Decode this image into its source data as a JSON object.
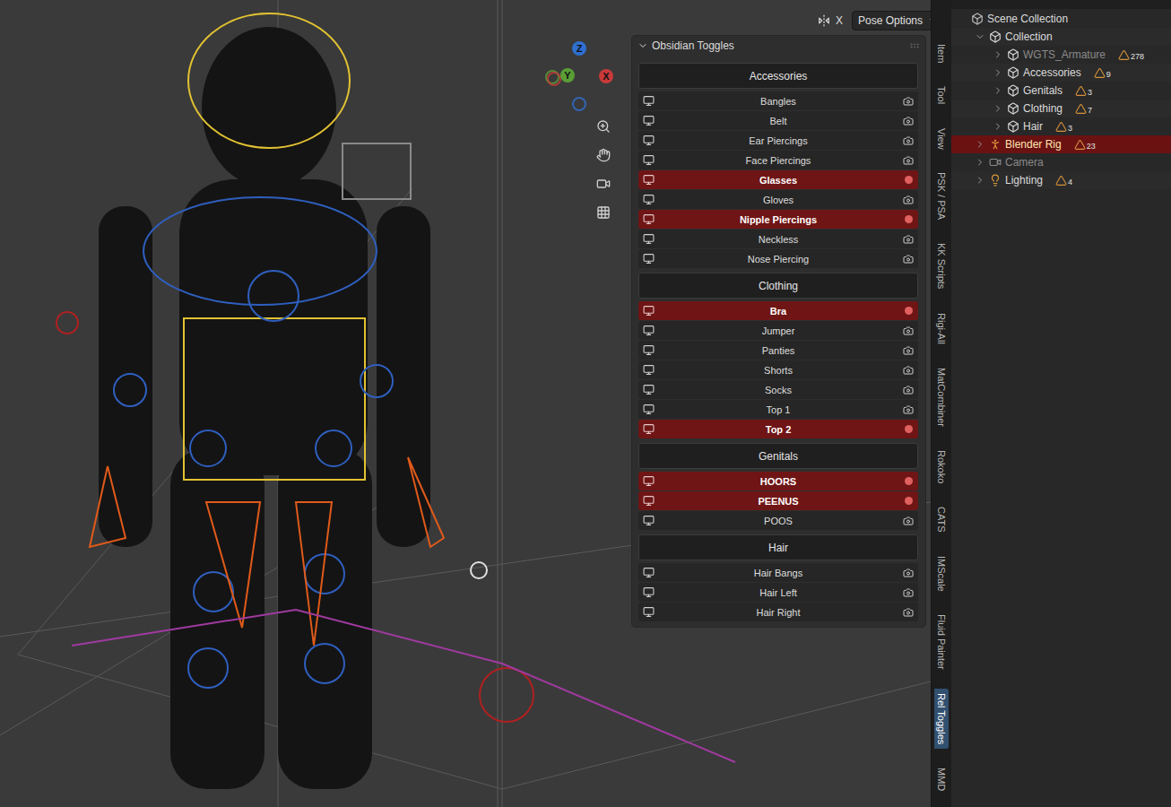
{
  "viewport": {
    "header": {
      "mirror_label": "X",
      "pose_options": "Pose Options"
    },
    "gizmo": [
      {
        "label": "Z",
        "color": "#2f6fd0"
      },
      {
        "label": "Y",
        "color": "#5a9e36"
      },
      {
        "label": "X",
        "color": "#c83a3a"
      }
    ]
  },
  "panel": {
    "title": "Obsidian Toggles",
    "expanded": true,
    "sections": [
      {
        "title": "Accessories",
        "items": [
          {
            "label": "Bangles",
            "hidden": false
          },
          {
            "label": "Belt",
            "hidden": false
          },
          {
            "label": "Ear Piercings",
            "hidden": false
          },
          {
            "label": "Face Piercings",
            "hidden": false
          },
          {
            "label": "Glasses",
            "hidden": true
          },
          {
            "label": "Gloves",
            "hidden": false
          },
          {
            "label": "Nipple Piercings",
            "hidden": true
          },
          {
            "label": "Neckless",
            "hidden": false
          },
          {
            "label": "Nose Piercing",
            "hidden": false
          }
        ]
      },
      {
        "title": "Clothing",
        "items": [
          {
            "label": "Bra",
            "hidden": true
          },
          {
            "label": "Jumper",
            "hidden": false
          },
          {
            "label": "Panties",
            "hidden": false
          },
          {
            "label": "Shorts",
            "hidden": false
          },
          {
            "label": "Socks",
            "hidden": false
          },
          {
            "label": "Top 1",
            "hidden": false
          },
          {
            "label": "Top 2",
            "hidden": true
          }
        ]
      },
      {
        "title": "Genitals",
        "items": [
          {
            "label": "HOORS",
            "hidden": true
          },
          {
            "label": "PEENUS",
            "hidden": true
          },
          {
            "label": "POOS",
            "hidden": false
          }
        ]
      },
      {
        "title": "Hair",
        "items": [
          {
            "label": "Hair Bangs",
            "hidden": false
          },
          {
            "label": "Hair Left",
            "hidden": false
          },
          {
            "label": "Hair Right",
            "hidden": false
          }
        ]
      }
    ]
  },
  "sidebar_tabs": [
    {
      "label": "Item",
      "selected": false
    },
    {
      "label": "Tool",
      "selected": false
    },
    {
      "label": "View",
      "selected": false
    },
    {
      "label": "PSK / PSA",
      "selected": false
    },
    {
      "label": "KK Scripts",
      "selected": false
    },
    {
      "label": "Rigi-All",
      "selected": false
    },
    {
      "label": "MatCombiner",
      "selected": false
    },
    {
      "label": "Rokoko",
      "selected": false
    },
    {
      "label": "CATS",
      "selected": false
    },
    {
      "label": "IMScale",
      "selected": false
    },
    {
      "label": "Fluid Painter",
      "selected": false
    },
    {
      "label": "Rel Toggles",
      "selected": true
    },
    {
      "label": "MMD",
      "selected": false
    }
  ],
  "outliner": {
    "rows": [
      {
        "label": "Scene Collection",
        "kind": "scene",
        "depth": 0,
        "expandable": false,
        "expanded": false,
        "dimmed": false,
        "selected": false,
        "count": ""
      },
      {
        "label": "Collection",
        "kind": "collection",
        "depth": 1,
        "expandable": true,
        "expanded": true,
        "dimmed": false,
        "selected": false,
        "count": ""
      },
      {
        "label": "WGTS_Armature",
        "kind": "collection",
        "depth": 2,
        "expandable": true,
        "expanded": false,
        "dimmed": true,
        "selected": false,
        "count": "278"
      },
      {
        "label": "Accessories",
        "kind": "collection",
        "depth": 2,
        "expandable": true,
        "expanded": false,
        "dimmed": false,
        "selected": false,
        "count": "9"
      },
      {
        "label": "Genitals",
        "kind": "collection",
        "depth": 2,
        "expandable": true,
        "expanded": false,
        "dimmed": false,
        "selected": false,
        "count": "3"
      },
      {
        "label": "Clothing",
        "kind": "collection",
        "depth": 2,
        "expandable": true,
        "expanded": false,
        "dimmed": false,
        "selected": false,
        "count": "7"
      },
      {
        "label": "Hair",
        "kind": "collection",
        "depth": 2,
        "expandable": true,
        "expanded": false,
        "dimmed": false,
        "selected": false,
        "count": "3"
      },
      {
        "label": "Blender Rig",
        "kind": "armature",
        "depth": 1,
        "expandable": true,
        "expanded": false,
        "dimmed": false,
        "selected": true,
        "count": "23"
      },
      {
        "label": "Camera",
        "kind": "camera",
        "depth": 1,
        "expandable": true,
        "expanded": false,
        "dimmed": true,
        "selected": false,
        "count": ""
      },
      {
        "label": "Lighting",
        "kind": "light",
        "depth": 1,
        "expandable": true,
        "expanded": false,
        "dimmed": false,
        "selected": false,
        "count": "4"
      }
    ]
  }
}
